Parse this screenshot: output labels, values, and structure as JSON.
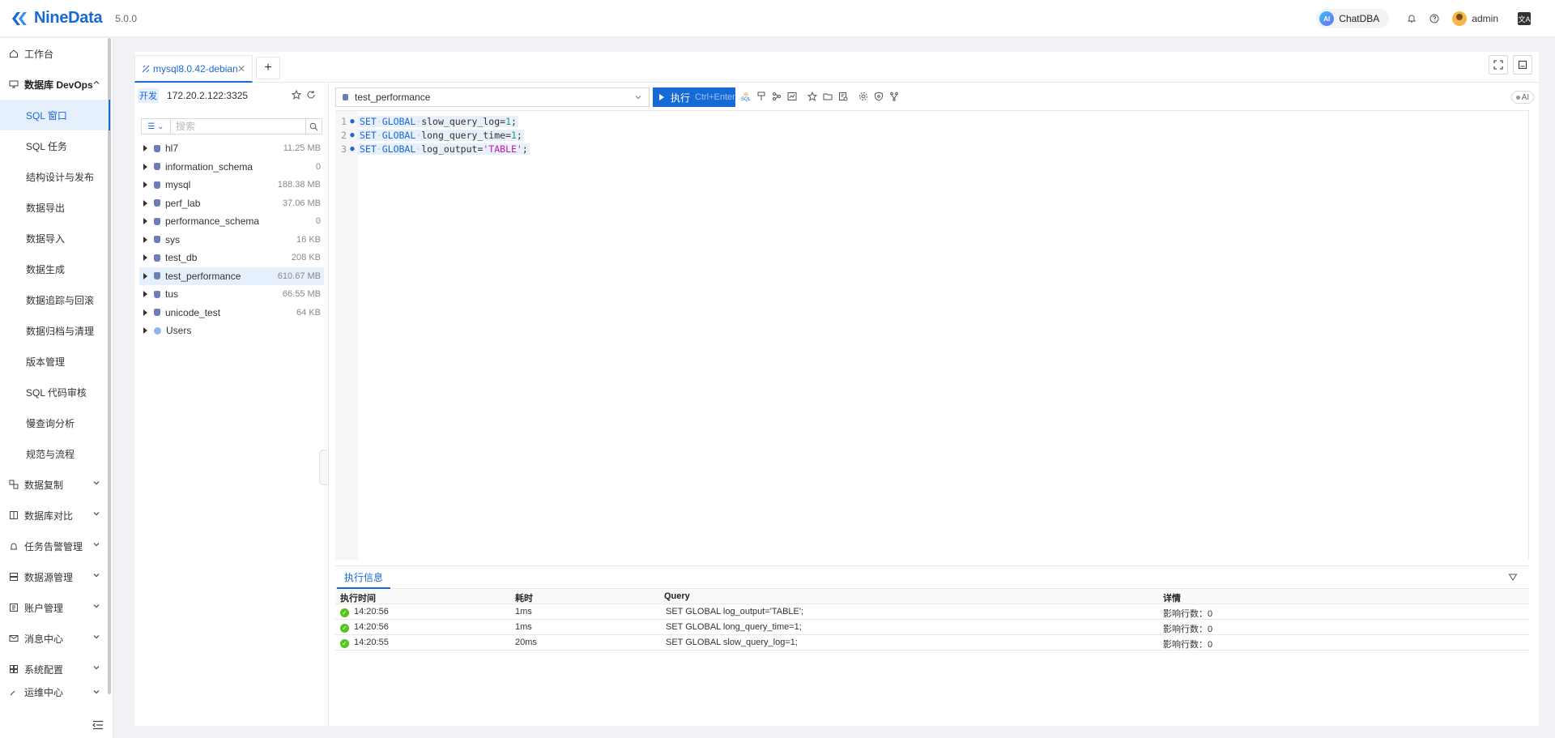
{
  "app": {
    "name": "NineData",
    "version": "5.0.0"
  },
  "header": {
    "chatdba_label": "ChatDBA",
    "chatdba_badge": "AI",
    "user_name": "admin",
    "lang_icon_text": "文A"
  },
  "sidebar": {
    "workbench": "工作台",
    "devops_group": "数据库 DevOps",
    "devops_items": [
      "SQL 窗口",
      "SQL 任务",
      "结构设计与发布",
      "数据导出",
      "数据导入",
      "数据生成",
      "数据追踪与回滚",
      "数据归档与清理",
      "版本管理",
      "SQL 代码审核",
      "慢查询分析",
      "规范与流程"
    ],
    "groups": [
      "数据复制",
      "数据库对比",
      "任务告警管理",
      "数据源管理",
      "账户管理",
      "消息中心",
      "系统配置",
      "运维中心"
    ]
  },
  "tabs": {
    "active_tab": "mysql8.0.42-debian",
    "add_label": "+"
  },
  "connection": {
    "env": "开发",
    "host": "172.20.2.122:3325"
  },
  "tree_search": {
    "placeholder": "搜索"
  },
  "tree": [
    {
      "name": "hl7",
      "size": "11.25 MB"
    },
    {
      "name": "information_schema",
      "size": "0"
    },
    {
      "name": "mysql",
      "size": "188.38 MB"
    },
    {
      "name": "perf_lab",
      "size": "37.06 MB"
    },
    {
      "name": "performance_schema",
      "size": "0"
    },
    {
      "name": "sys",
      "size": "16 KB"
    },
    {
      "name": "test_db",
      "size": "208 KB"
    },
    {
      "name": "test_performance",
      "size": "610.67 MB"
    },
    {
      "name": "tus",
      "size": "66.55 MB"
    },
    {
      "name": "unicode_test",
      "size": "64 KB"
    },
    {
      "name": "Users",
      "size": ""
    }
  ],
  "editor": {
    "database": "test_performance",
    "run_label": "执行",
    "run_shortcut": "Ctrl+Enter",
    "ai_toggle": "AI",
    "lines": [
      {
        "n": "1",
        "kw1": "SET",
        "kw2": "GLOBAL",
        "name": "slow_query_log=",
        "val": "1",
        "val_type": "num"
      },
      {
        "n": "2",
        "kw1": "SET",
        "kw2": "GLOBAL",
        "name": "long_query_time=",
        "val": "1",
        "val_type": "num"
      },
      {
        "n": "3",
        "kw1": "SET",
        "kw2": "GLOBAL",
        "name": "log_output=",
        "val": "'TABLE'",
        "val_type": "str"
      }
    ]
  },
  "result": {
    "tab_label": "执行信息",
    "columns": [
      "执行时间",
      "耗时",
      "Query",
      "详情"
    ],
    "rows": [
      {
        "time": "14:20:56",
        "duration": "1ms",
        "query": "SET GLOBAL log_output='TABLE';",
        "detail": "影响行数：0"
      },
      {
        "time": "14:20:56",
        "duration": "1ms",
        "query": "SET GLOBAL long_query_time=1;",
        "detail": "影响行数：0"
      },
      {
        "time": "14:20:55",
        "duration": "20ms",
        "query": "SET GLOBAL slow_query_log=1;",
        "detail": "影响行数：0"
      }
    ]
  },
  "colors": {
    "brand": "#1769d6",
    "success": "#52c41a",
    "active_bg": "#e6f0fc"
  }
}
